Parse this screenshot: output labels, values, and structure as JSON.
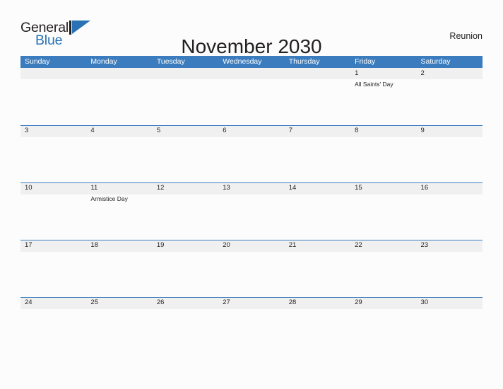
{
  "brand": {
    "name_part1": "General",
    "name_part2": "Blue",
    "flag_icon": "flag-triangle-icon",
    "accent_color": "#2a72b5"
  },
  "header": {
    "title": "November 2030",
    "region": "Reunion"
  },
  "calendar": {
    "header_color": "#3b7cbe",
    "band_color": "#f0f0f0",
    "weekdays": [
      "Sunday",
      "Monday",
      "Tuesday",
      "Wednesday",
      "Thursday",
      "Friday",
      "Saturday"
    ],
    "weeks": [
      [
        {
          "day": "",
          "event": ""
        },
        {
          "day": "",
          "event": ""
        },
        {
          "day": "",
          "event": ""
        },
        {
          "day": "",
          "event": ""
        },
        {
          "day": "",
          "event": ""
        },
        {
          "day": "1",
          "event": "All Saints' Day"
        },
        {
          "day": "2",
          "event": ""
        }
      ],
      [
        {
          "day": "3",
          "event": ""
        },
        {
          "day": "4",
          "event": ""
        },
        {
          "day": "5",
          "event": ""
        },
        {
          "day": "6",
          "event": ""
        },
        {
          "day": "7",
          "event": ""
        },
        {
          "day": "8",
          "event": ""
        },
        {
          "day": "9",
          "event": ""
        }
      ],
      [
        {
          "day": "10",
          "event": ""
        },
        {
          "day": "11",
          "event": "Armistice Day"
        },
        {
          "day": "12",
          "event": ""
        },
        {
          "day": "13",
          "event": ""
        },
        {
          "day": "14",
          "event": ""
        },
        {
          "day": "15",
          "event": ""
        },
        {
          "day": "16",
          "event": ""
        }
      ],
      [
        {
          "day": "17",
          "event": ""
        },
        {
          "day": "18",
          "event": ""
        },
        {
          "day": "19",
          "event": ""
        },
        {
          "day": "20",
          "event": ""
        },
        {
          "day": "21",
          "event": ""
        },
        {
          "day": "22",
          "event": ""
        },
        {
          "day": "23",
          "event": ""
        }
      ],
      [
        {
          "day": "24",
          "event": ""
        },
        {
          "day": "25",
          "event": ""
        },
        {
          "day": "26",
          "event": ""
        },
        {
          "day": "27",
          "event": ""
        },
        {
          "day": "28",
          "event": ""
        },
        {
          "day": "29",
          "event": ""
        },
        {
          "day": "30",
          "event": ""
        }
      ]
    ]
  }
}
